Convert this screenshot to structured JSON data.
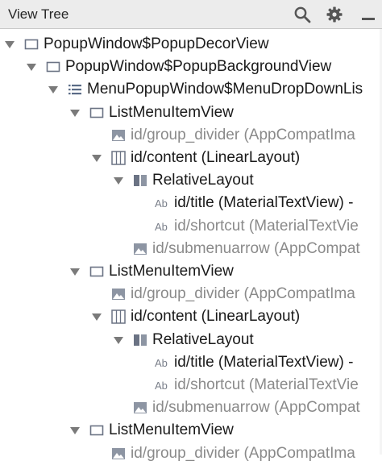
{
  "header": {
    "title": "View Tree",
    "icons": [
      "search-icon",
      "gear-icon"
    ]
  },
  "colors": {
    "header_bg": "#ececec",
    "text": "#1a1a1a",
    "muted_text": "#8a8a8a",
    "icon_gray": "#7a7a7a",
    "layout_blue": "#5a6b86"
  },
  "tree": {
    "nodes": [
      {
        "label": "PopupWindow$PopupDecorView",
        "icon": "view-frame-icon",
        "expanded": true,
        "muted": false
      },
      {
        "label": "PopupWindow$PopupBackgroundView",
        "icon": "view-frame-icon",
        "expanded": true,
        "muted": false
      },
      {
        "label": "MenuPopupWindow$MenuDropDownLis",
        "icon": "list-icon",
        "expanded": true,
        "muted": false
      },
      {
        "label": "ListMenuItemView",
        "icon": "view-frame-icon",
        "expanded": true,
        "muted": false
      },
      {
        "label": "id/group_divider (AppCompatIma",
        "icon": "image-icon",
        "expanded": null,
        "muted": true
      },
      {
        "label": "id/content (LinearLayout)",
        "icon": "linear-layout-icon",
        "expanded": true,
        "muted": false
      },
      {
        "label": "RelativeLayout",
        "icon": "relative-layout-icon",
        "expanded": true,
        "muted": false
      },
      {
        "label": "id/title (MaterialTextView) -",
        "icon": "text-view-icon",
        "expanded": null,
        "muted": false
      },
      {
        "label": "id/shortcut (MaterialTextVie",
        "icon": "text-view-icon",
        "expanded": null,
        "muted": true
      },
      {
        "label": "id/submenuarrow (AppCompat",
        "icon": "image-icon",
        "expanded": null,
        "muted": true
      },
      {
        "label": "ListMenuItemView",
        "icon": "view-frame-icon",
        "expanded": true,
        "muted": false
      },
      {
        "label": "id/group_divider (AppCompatIma",
        "icon": "image-icon",
        "expanded": null,
        "muted": true
      },
      {
        "label": "id/content (LinearLayout)",
        "icon": "linear-layout-icon",
        "expanded": true,
        "muted": false
      },
      {
        "label": "RelativeLayout",
        "icon": "relative-layout-icon",
        "expanded": true,
        "muted": false
      },
      {
        "label": "id/title (MaterialTextView) -",
        "icon": "text-view-icon",
        "expanded": null,
        "muted": false
      },
      {
        "label": "id/shortcut (MaterialTextVie",
        "icon": "text-view-icon",
        "expanded": null,
        "muted": true
      },
      {
        "label": "id/submenuarrow (AppCompat",
        "icon": "image-icon",
        "expanded": null,
        "muted": true
      },
      {
        "label": "ListMenuItemView",
        "icon": "view-frame-icon",
        "expanded": true,
        "muted": false
      },
      {
        "label": "id/group_divider (AppCompatIma",
        "icon": "image-icon",
        "expanded": null,
        "muted": true
      }
    ]
  }
}
